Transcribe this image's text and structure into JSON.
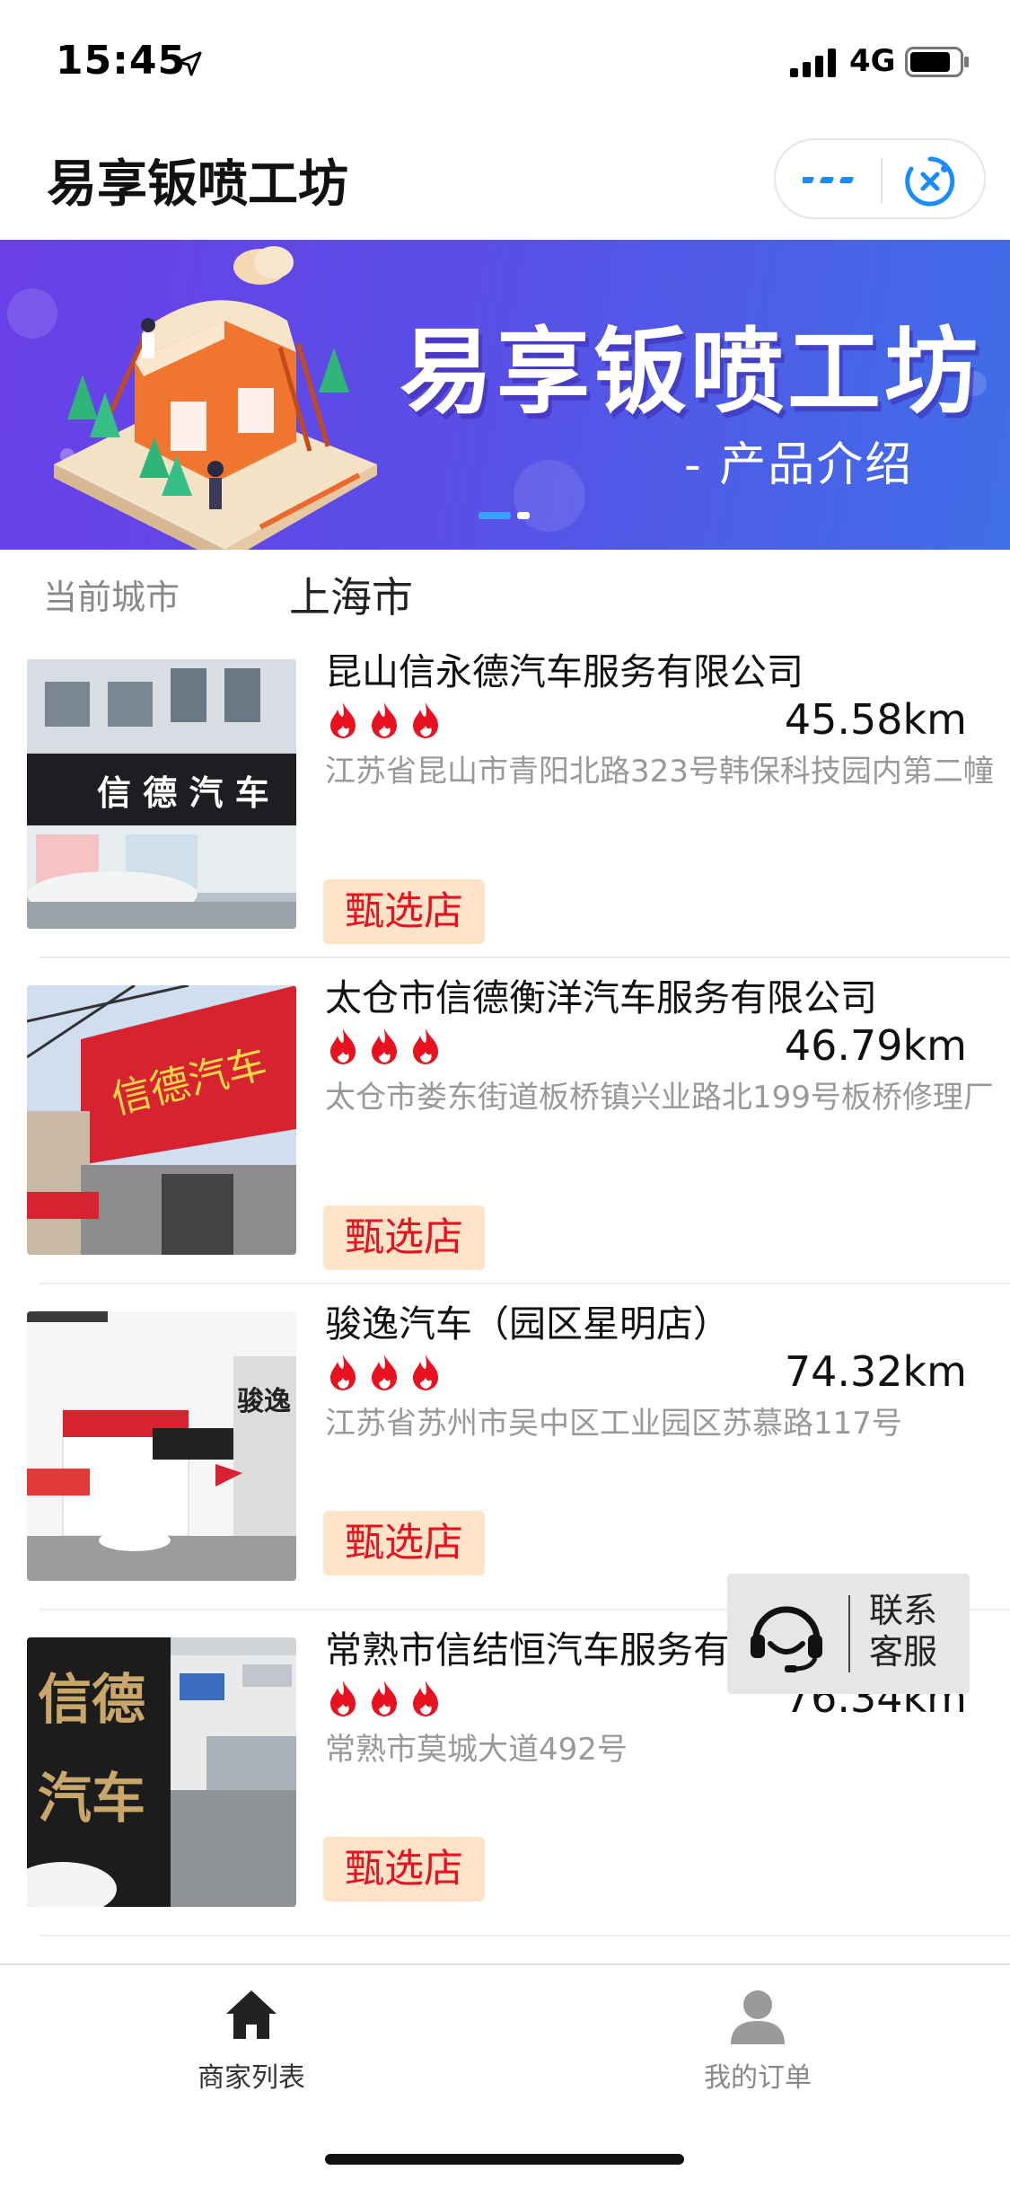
{
  "status_bar": {
    "time": "15:45",
    "network": "4G"
  },
  "nav": {
    "title": "易享钣喷工坊"
  },
  "banner": {
    "title": "易享钣喷工坊",
    "subtitle": "- 产品介绍",
    "page_count": 2,
    "active_page": 1
  },
  "city": {
    "label": "当前城市",
    "value": "上海市"
  },
  "shops": [
    {
      "name": "昆山信永德汽车服务有限公司",
      "rating_flames": 3,
      "distance": "45.58km",
      "address": "江苏省昆山市青阳北路323号韩保科技园内第二幢",
      "badge": "甄选店",
      "photo_icon": "storefront-photo"
    },
    {
      "name": "太仓市信德衡洋汽车服务有限公司",
      "rating_flames": 3,
      "distance": "46.79km",
      "address": "太仓市娄东街道板桥镇兴业路北199号板桥修理厂",
      "badge": "甄选店",
      "photo_icon": "storefront-photo"
    },
    {
      "name": "骏逸汽车（园区星明店）",
      "rating_flames": 3,
      "distance": "74.32km",
      "address": "江苏省苏州市吴中区工业园区苏慕路117号",
      "badge": "甄选店",
      "photo_icon": "storefront-photo"
    },
    {
      "name": "常熟市信结恒汽车服务有限公司",
      "rating_flames": 3,
      "distance": "76.34km",
      "address": "常熟市莫城大道492号",
      "badge": "甄选店",
      "photo_icon": "storefront-photo"
    }
  ],
  "customer_service": {
    "label": "联系客服",
    "icon": "headset-icon"
  },
  "tab_bar": {
    "tabs": [
      {
        "label": "商家列表",
        "icon": "home-icon",
        "active": true
      },
      {
        "label": "我的订单",
        "icon": "user-icon",
        "active": false
      }
    ]
  },
  "colors": {
    "flame": "#e8111f",
    "badge_bg": "#fde3c8",
    "badge_text": "#e8111f",
    "accent": "#1a8cff"
  }
}
